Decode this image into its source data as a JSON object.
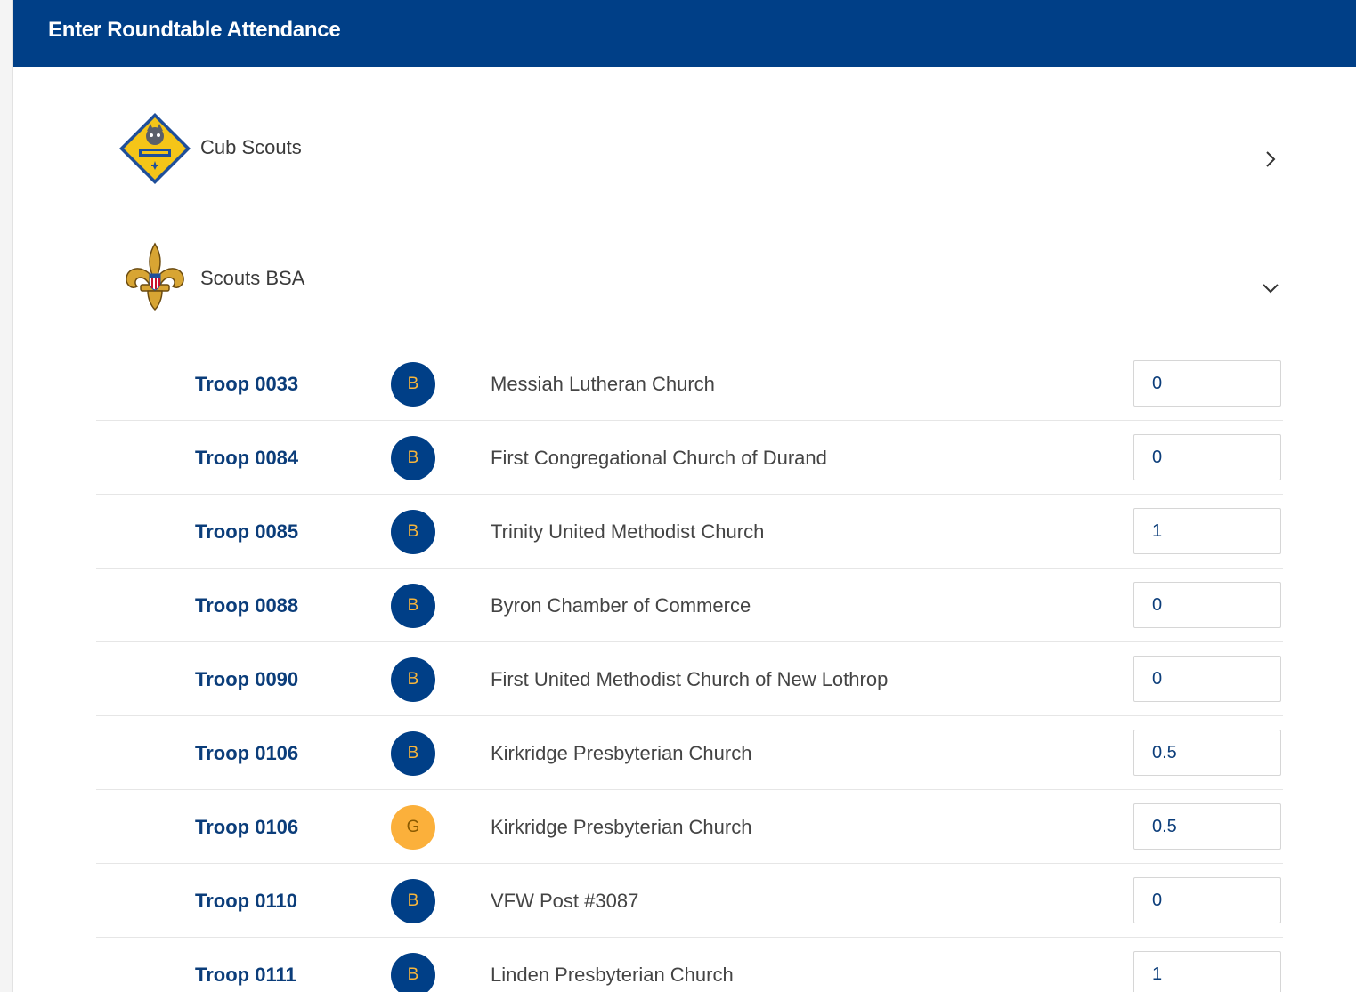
{
  "header": {
    "title": "Enter Roundtable Attendance"
  },
  "sections": [
    {
      "label": "Cub Scouts",
      "icon": "cub-scouts-logo-icon",
      "state": "collapsed",
      "chevron": "chevron-right-icon"
    },
    {
      "label": "Scouts BSA",
      "icon": "scouts-bsa-fleur-de-lis-icon",
      "state": "expanded",
      "chevron": "chevron-down-icon"
    }
  ],
  "troops": [
    {
      "unit": "Troop 0033",
      "badge": "B",
      "org": "Messiah Lutheran Church",
      "count": "0"
    },
    {
      "unit": "Troop 0084",
      "badge": "B",
      "org": "First Congregational Church of Durand",
      "count": "0"
    },
    {
      "unit": "Troop 0085",
      "badge": "B",
      "org": "Trinity United Methodist Church",
      "count": "1"
    },
    {
      "unit": "Troop 0088",
      "badge": "B",
      "org": "Byron Chamber of Commerce",
      "count": "0"
    },
    {
      "unit": "Troop 0090",
      "badge": "B",
      "org": "First United Methodist Church of New Lothrop",
      "count": "0"
    },
    {
      "unit": "Troop 0106",
      "badge": "B",
      "org": "Kirkridge Presbyterian Church",
      "count": "0.5"
    },
    {
      "unit": "Troop 0106",
      "badge": "G",
      "org": "Kirkridge Presbyterian Church",
      "count": "0.5"
    },
    {
      "unit": "Troop 0110",
      "badge": "B",
      "org": "VFW Post #3087",
      "count": "0"
    },
    {
      "unit": "Troop 0111",
      "badge": "B",
      "org": "Linden Presbyterian Church",
      "count": "1"
    }
  ],
  "colors": {
    "header_bg": "#003f87",
    "unit_text": "#0b3d7a",
    "badge_b_bg": "#003f87",
    "badge_b_text": "#f6b53c",
    "badge_g_bg": "#fbb03b"
  }
}
